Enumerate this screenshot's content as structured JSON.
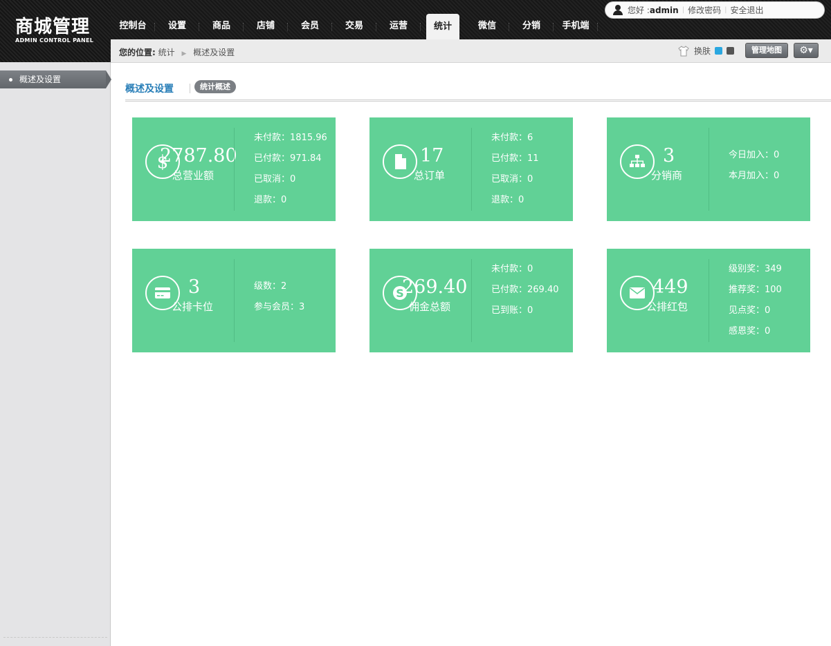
{
  "logo": {
    "title": "商城管理",
    "subtitle": "ADMIN CONTROL PANEL"
  },
  "nav": [
    "控制台",
    "设置",
    "商品",
    "店铺",
    "会员",
    "交易",
    "运营",
    "统计",
    "微信",
    "分销",
    "手机端"
  ],
  "nav_active": "统计",
  "user": {
    "greeting": "您好 : ",
    "name": "admin",
    "change_password": "修改密码",
    "logout": "安全退出"
  },
  "breadcrumb": {
    "label": "您的位置:",
    "level1": "统计",
    "level2": "概述及设置"
  },
  "skin": {
    "label": "换肤",
    "colors": [
      "#2aa7e0",
      "#555555"
    ]
  },
  "buttons": {
    "sitemap": "管理地图",
    "settings": "⚙▾"
  },
  "sidebar": {
    "items": [
      {
        "label": "概述及设置"
      }
    ]
  },
  "tabs": {
    "title": "概述及设置",
    "pill": "统计概述"
  },
  "cards": [
    {
      "icon": "dollar-icon",
      "value": "2787.80",
      "label": "总营业额",
      "stats": [
        "未付款：1815.96",
        "已付款：971.84",
        "已取消：0",
        "退款：0"
      ]
    },
    {
      "icon": "file-icon",
      "value": "17",
      "label": "总订单",
      "stats": [
        "未付款：6",
        "已付款：11",
        "已取消：0",
        "退款：0"
      ]
    },
    {
      "icon": "sitemap-icon",
      "value": "3",
      "label": "分销商",
      "stats": [
        "今日加入：0",
        "本月加入：0"
      ]
    },
    {
      "icon": "credit-card-icon",
      "value": "3",
      "label": "公排卡位",
      "stats": [
        "级数：2",
        "参与会员：3"
      ]
    },
    {
      "icon": "skype-icon",
      "value": "269.40",
      "label": "佣金总额",
      "stats": [
        "未付款：0",
        "已付款：269.40",
        "已到账：0"
      ]
    },
    {
      "icon": "envelope-icon",
      "value": "449",
      "label": "公排红包",
      "stats": [
        "级别奖：349",
        "推荐奖：100",
        "见点奖：0",
        "感恩奖：0"
      ]
    }
  ]
}
